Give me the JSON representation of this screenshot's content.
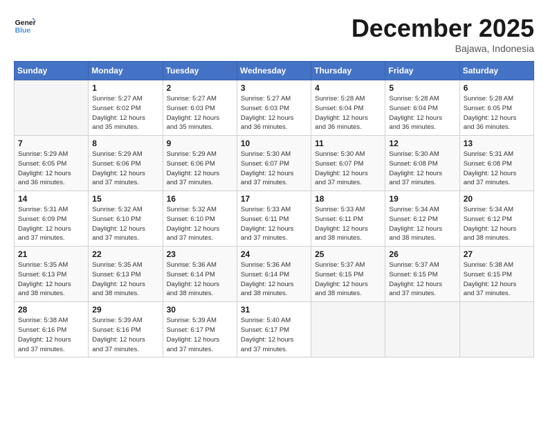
{
  "header": {
    "logo_line1": "General",
    "logo_line2": "Blue",
    "month_year": "December 2025",
    "location": "Bajawa, Indonesia"
  },
  "weekdays": [
    "Sunday",
    "Monday",
    "Tuesday",
    "Wednesday",
    "Thursday",
    "Friday",
    "Saturday"
  ],
  "weeks": [
    [
      {
        "day": "",
        "info": ""
      },
      {
        "day": "1",
        "info": "Sunrise: 5:27 AM\nSunset: 6:02 PM\nDaylight: 12 hours\nand 35 minutes."
      },
      {
        "day": "2",
        "info": "Sunrise: 5:27 AM\nSunset: 6:03 PM\nDaylight: 12 hours\nand 35 minutes."
      },
      {
        "day": "3",
        "info": "Sunrise: 5:27 AM\nSunset: 6:03 PM\nDaylight: 12 hours\nand 36 minutes."
      },
      {
        "day": "4",
        "info": "Sunrise: 5:28 AM\nSunset: 6:04 PM\nDaylight: 12 hours\nand 36 minutes."
      },
      {
        "day": "5",
        "info": "Sunrise: 5:28 AM\nSunset: 6:04 PM\nDaylight: 12 hours\nand 36 minutes."
      },
      {
        "day": "6",
        "info": "Sunrise: 5:28 AM\nSunset: 6:05 PM\nDaylight: 12 hours\nand 36 minutes."
      }
    ],
    [
      {
        "day": "7",
        "info": "Sunrise: 5:29 AM\nSunset: 6:05 PM\nDaylight: 12 hours\nand 36 minutes."
      },
      {
        "day": "8",
        "info": "Sunrise: 5:29 AM\nSunset: 6:06 PM\nDaylight: 12 hours\nand 37 minutes."
      },
      {
        "day": "9",
        "info": "Sunrise: 5:29 AM\nSunset: 6:06 PM\nDaylight: 12 hours\nand 37 minutes."
      },
      {
        "day": "10",
        "info": "Sunrise: 5:30 AM\nSunset: 6:07 PM\nDaylight: 12 hours\nand 37 minutes."
      },
      {
        "day": "11",
        "info": "Sunrise: 5:30 AM\nSunset: 6:07 PM\nDaylight: 12 hours\nand 37 minutes."
      },
      {
        "day": "12",
        "info": "Sunrise: 5:30 AM\nSunset: 6:08 PM\nDaylight: 12 hours\nand 37 minutes."
      },
      {
        "day": "13",
        "info": "Sunrise: 5:31 AM\nSunset: 6:08 PM\nDaylight: 12 hours\nand 37 minutes."
      }
    ],
    [
      {
        "day": "14",
        "info": "Sunrise: 5:31 AM\nSunset: 6:09 PM\nDaylight: 12 hours\nand 37 minutes."
      },
      {
        "day": "15",
        "info": "Sunrise: 5:32 AM\nSunset: 6:10 PM\nDaylight: 12 hours\nand 37 minutes."
      },
      {
        "day": "16",
        "info": "Sunrise: 5:32 AM\nSunset: 6:10 PM\nDaylight: 12 hours\nand 37 minutes."
      },
      {
        "day": "17",
        "info": "Sunrise: 5:33 AM\nSunset: 6:11 PM\nDaylight: 12 hours\nand 37 minutes."
      },
      {
        "day": "18",
        "info": "Sunrise: 5:33 AM\nSunset: 6:11 PM\nDaylight: 12 hours\nand 38 minutes."
      },
      {
        "day": "19",
        "info": "Sunrise: 5:34 AM\nSunset: 6:12 PM\nDaylight: 12 hours\nand 38 minutes."
      },
      {
        "day": "20",
        "info": "Sunrise: 5:34 AM\nSunset: 6:12 PM\nDaylight: 12 hours\nand 38 minutes."
      }
    ],
    [
      {
        "day": "21",
        "info": "Sunrise: 5:35 AM\nSunset: 6:13 PM\nDaylight: 12 hours\nand 38 minutes."
      },
      {
        "day": "22",
        "info": "Sunrise: 5:35 AM\nSunset: 6:13 PM\nDaylight: 12 hours\nand 38 minutes."
      },
      {
        "day": "23",
        "info": "Sunrise: 5:36 AM\nSunset: 6:14 PM\nDaylight: 12 hours\nand 38 minutes."
      },
      {
        "day": "24",
        "info": "Sunrise: 5:36 AM\nSunset: 6:14 PM\nDaylight: 12 hours\nand 38 minutes."
      },
      {
        "day": "25",
        "info": "Sunrise: 5:37 AM\nSunset: 6:15 PM\nDaylight: 12 hours\nand 38 minutes."
      },
      {
        "day": "26",
        "info": "Sunrise: 5:37 AM\nSunset: 6:15 PM\nDaylight: 12 hours\nand 37 minutes."
      },
      {
        "day": "27",
        "info": "Sunrise: 5:38 AM\nSunset: 6:15 PM\nDaylight: 12 hours\nand 37 minutes."
      }
    ],
    [
      {
        "day": "28",
        "info": "Sunrise: 5:38 AM\nSunset: 6:16 PM\nDaylight: 12 hours\nand 37 minutes."
      },
      {
        "day": "29",
        "info": "Sunrise: 5:39 AM\nSunset: 6:16 PM\nDaylight: 12 hours\nand 37 minutes."
      },
      {
        "day": "30",
        "info": "Sunrise: 5:39 AM\nSunset: 6:17 PM\nDaylight: 12 hours\nand 37 minutes."
      },
      {
        "day": "31",
        "info": "Sunrise: 5:40 AM\nSunset: 6:17 PM\nDaylight: 12 hours\nand 37 minutes."
      },
      {
        "day": "",
        "info": ""
      },
      {
        "day": "",
        "info": ""
      },
      {
        "day": "",
        "info": ""
      }
    ]
  ]
}
